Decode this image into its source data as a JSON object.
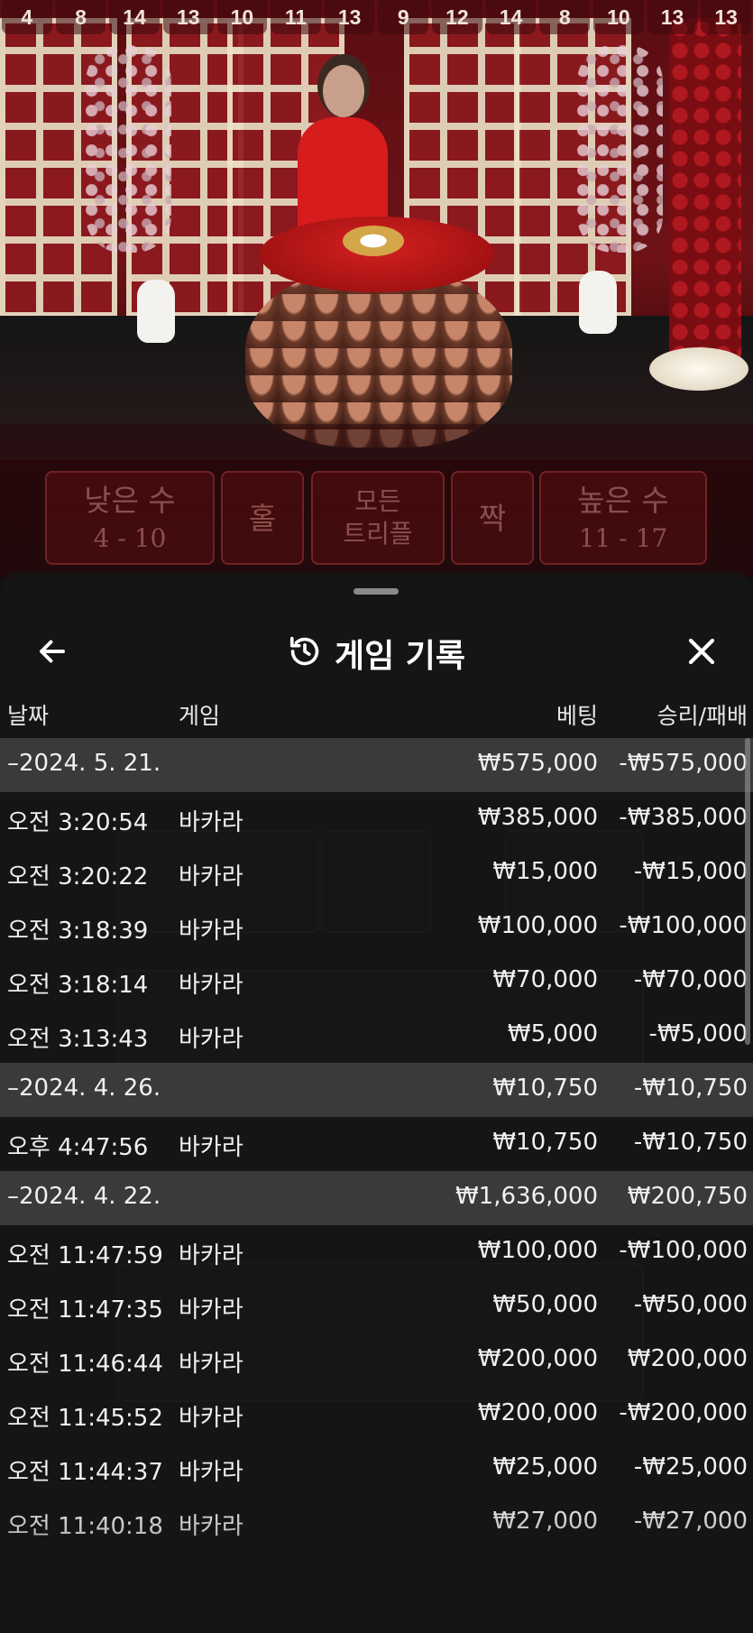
{
  "stats": [
    {
      "value": "4"
    },
    {
      "value": "8"
    },
    {
      "value": "14"
    },
    {
      "value": "13"
    },
    {
      "value": "10"
    },
    {
      "value": "11"
    },
    {
      "value": "13"
    },
    {
      "value": "9"
    },
    {
      "value": "12"
    },
    {
      "value": "14"
    },
    {
      "value": "8"
    },
    {
      "value": "10"
    },
    {
      "value": "13"
    },
    {
      "value": "13"
    }
  ],
  "bet_area": {
    "low": {
      "label": "낮은 수",
      "range": "4 - 10"
    },
    "odd": {
      "label": "홀"
    },
    "triple": {
      "label_line1": "모든",
      "label_line2": "트리플"
    },
    "even": {
      "label": "짝"
    },
    "high": {
      "label": "높은 수",
      "range": "11 - 17"
    }
  },
  "sheet": {
    "title": "게임 기록",
    "columns": {
      "date": "날짜",
      "game": "게임",
      "bet": "베팅",
      "winloss": "승리/패배"
    },
    "rows": [
      {
        "group": true,
        "date": "–2024. 5. 21.",
        "game": "",
        "bet": "₩575,000",
        "winloss": "-₩575,000"
      },
      {
        "group": false,
        "date": "오전 3:20:54",
        "game": "바카라",
        "bet": "₩385,000",
        "winloss": "-₩385,000"
      },
      {
        "group": false,
        "date": "오전 3:20:22",
        "game": "바카라",
        "bet": "₩15,000",
        "winloss": "-₩15,000"
      },
      {
        "group": false,
        "date": "오전 3:18:39",
        "game": "바카라",
        "bet": "₩100,000",
        "winloss": "-₩100,000"
      },
      {
        "group": false,
        "date": "오전 3:18:14",
        "game": "바카라",
        "bet": "₩70,000",
        "winloss": "-₩70,000"
      },
      {
        "group": false,
        "date": "오전 3:13:43",
        "game": "바카라",
        "bet": "₩5,000",
        "winloss": "-₩5,000"
      },
      {
        "group": true,
        "date": "–2024. 4. 26.",
        "game": "",
        "bet": "₩10,750",
        "winloss": "-₩10,750"
      },
      {
        "group": false,
        "date": "오후 4:47:56",
        "game": "바카라",
        "bet": "₩10,750",
        "winloss": "-₩10,750"
      },
      {
        "group": true,
        "date": "–2024. 4. 22.",
        "game": "",
        "bet": "₩1,636,000",
        "winloss": "₩200,750"
      },
      {
        "group": false,
        "date": "오전 11:47:59",
        "game": "바카라",
        "bet": "₩100,000",
        "winloss": "-₩100,000"
      },
      {
        "group": false,
        "date": "오전 11:47:35",
        "game": "바카라",
        "bet": "₩50,000",
        "winloss": "-₩50,000"
      },
      {
        "group": false,
        "date": "오전 11:46:44",
        "game": "바카라",
        "bet": "₩200,000",
        "winloss": "₩200,000"
      },
      {
        "group": false,
        "date": "오전 11:45:52",
        "game": "바카라",
        "bet": "₩200,000",
        "winloss": "-₩200,000"
      },
      {
        "group": false,
        "date": "오전 11:44:37",
        "game": "바카라",
        "bet": "₩25,000",
        "winloss": "-₩25,000"
      },
      {
        "group": false,
        "date": "오전 11:40:18",
        "game": "바카라",
        "bet": "₩27,000",
        "winloss": "-₩27,000"
      }
    ]
  },
  "icons": {
    "back": "arrow-left-icon",
    "history": "history-icon",
    "close": "close-icon"
  }
}
